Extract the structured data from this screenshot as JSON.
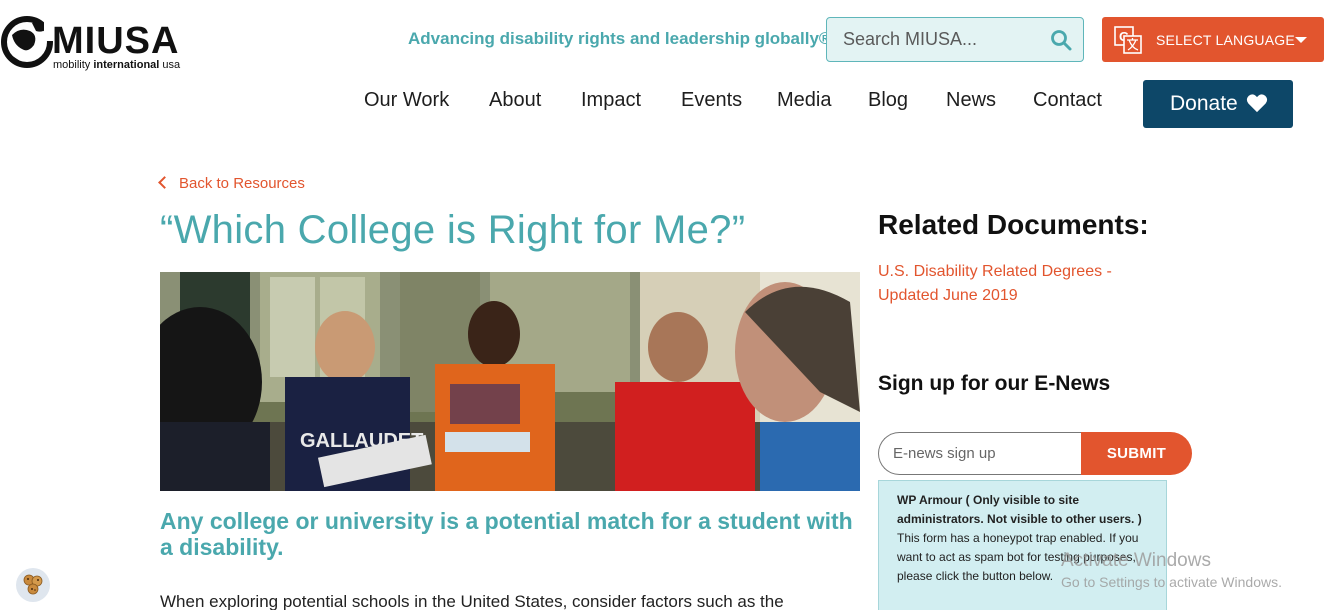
{
  "header": {
    "logo": {
      "wordmark": "MIUSA",
      "sub_regular": "mobility ",
      "sub_bold": "international",
      "sub_end": " usa"
    },
    "tagline": "Advancing disability rights and leadership globally®",
    "search": {
      "placeholder": "Search MIUSA..."
    },
    "language_button": "SELECT LANGUAGE",
    "nav": [
      "Our Work",
      "About",
      "Impact",
      "Events",
      "Media",
      "Blog",
      "News",
      "Contact"
    ],
    "donate": "Donate"
  },
  "main": {
    "back_link": "Back to Resources",
    "title": "“Which College is Right for Me?”",
    "subtitle": "Any college or university is a potential match for a student with a disability.",
    "body_start": "When exploring potential schools in the United States, consider factors such as the"
  },
  "sidebar": {
    "related_title": "Related Documents:",
    "related_link": "U.S. Disability Related Degrees - Updated June 2019",
    "enews_title": "Sign up for our E-News",
    "enews_placeholder": "E-news sign up",
    "submit": "SUBMIT",
    "wp_armour": {
      "heading": "WP Armour ( Only visible to site administrators. Not visible to other users. )",
      "text": "This form has a honeypot trap enabled. If you want to act as spam bot for testing purposes, please click the button below."
    }
  },
  "overlay": {
    "activate_title": "Activate Windows",
    "activate_sub": "Go to Settings to activate Windows."
  },
  "colors": {
    "teal": "#4aa8ad",
    "orange": "#e2552e",
    "navy": "#0d4768"
  },
  "icons": [
    "globe-logo-icon",
    "search-icon",
    "translate-icon",
    "caret-down-icon",
    "heart-icon",
    "chevron-left-icon",
    "cookie-icon"
  ]
}
